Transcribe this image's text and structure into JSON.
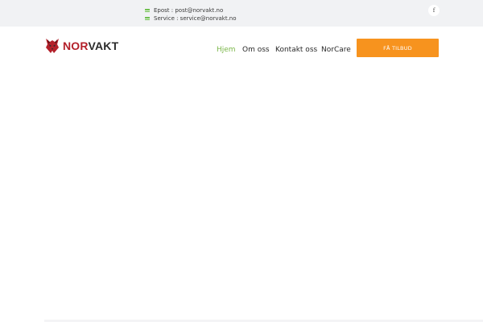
{
  "topbar": {
    "email_label": "Epost : post@norvakt.no",
    "service_label": "Service : service@norvakt.no",
    "facebook_glyph": "f"
  },
  "logo": {
    "text_part1": "NOR",
    "text_part2": "VAKT",
    "icon": "wolf-head-icon"
  },
  "nav": {
    "items": [
      {
        "label": "Hjem",
        "active": true
      },
      {
        "label": "Om oss",
        "active": false
      },
      {
        "label": "Kontakt oss",
        "active": false
      },
      {
        "label": "NorCare",
        "active": false
      }
    ]
  },
  "cta": {
    "label": "FÅ TILBUD"
  },
  "colors": {
    "accent_green": "#7ab648",
    "cta_orange": "#f7931e",
    "brand_red": "#b3202a",
    "topbar_bg": "#f1f2f4"
  }
}
